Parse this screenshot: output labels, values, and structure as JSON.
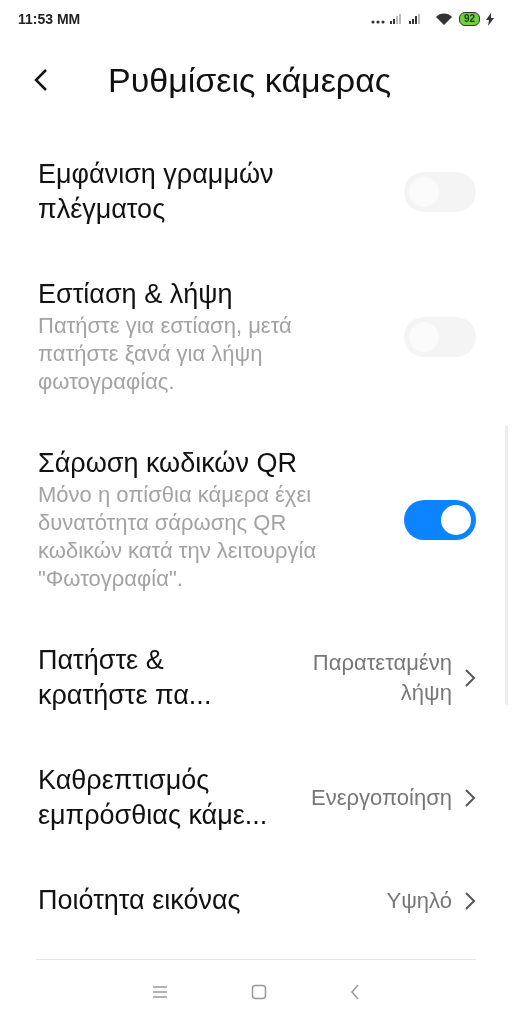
{
  "status_bar": {
    "time": "11:53 MM",
    "battery": "92"
  },
  "header": {
    "title": "Ρυθμίσεις κάμερας"
  },
  "settings": [
    {
      "kind": "toggle",
      "title": "Εμφάνιση γραμμών πλέγματος",
      "on": false
    },
    {
      "kind": "toggle",
      "title": "Εστίαση & λήψη",
      "description": "Πατήστε για εστίαση, μετά πατήστε ξανά για λήψη φωτογραφίας.",
      "on": false
    },
    {
      "kind": "toggle",
      "title": "Σάρωση κωδικών QR",
      "description": "Μόνο η οπίσθια κάμερα έχει δυνατότητα σάρωσης QR κωδικών κατά την λειτουργία \"Φωτογραφία\".",
      "on": true
    },
    {
      "kind": "value",
      "title": "Πατήστε & κρατήστε πα...",
      "value": "Παρατεταμένη λήψη"
    },
    {
      "kind": "value",
      "title": "Καθρεπτισμός εμπρόσθιας κάμε...",
      "value": "Ενεργοποίηση"
    },
    {
      "kind": "value",
      "title": "Ποιότητα εικόνας",
      "value": "Υψηλό"
    }
  ]
}
